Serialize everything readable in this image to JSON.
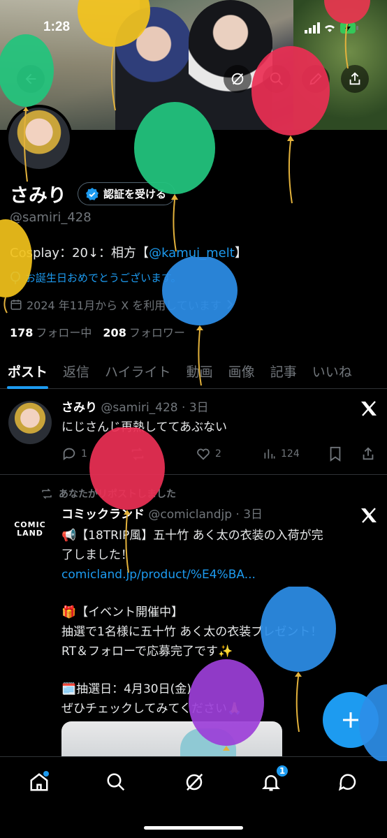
{
  "status_bar": {
    "time": "1:28"
  },
  "profile": {
    "name": "さみり",
    "verify_label": "認証を受ける",
    "handle": "@samiri_428",
    "bio_prefix": "Cosplay：20↓：相方【",
    "bio_mention": "@kamui_melt",
    "bio_suffix": "】",
    "birthday": "お誕生日おめでとうございます。",
    "joined": "2024 年11月から X を利用しています",
    "following_count": "178",
    "following_label": "フォロー中",
    "followers_count": "208",
    "followers_label": "フォロワー"
  },
  "tabs": [
    "ポスト",
    "返信",
    "ハイライト",
    "動画",
    "画像",
    "記事",
    "いいね"
  ],
  "post1": {
    "name": "さみり",
    "handle_time": "@samiri_428 · 3日",
    "text": "にじさんじ再熱しててあぶない",
    "reply_count": "1",
    "like_count": "2",
    "view_count": "124"
  },
  "post2": {
    "repost_label": "あなたがリポストしました",
    "logo_text_1": "COMIC",
    "logo_text_2": "LAND",
    "name": "コミックランド",
    "handle_time": "@comiclandjp · 3日",
    "line1": "📢【18TRIP風】五十竹 あく太の衣装の入荷が完",
    "line2": "了しました！",
    "link": "comicland.jp/product/%E4%BA...",
    "line3": "🎁【イベント開催中】",
    "line4": "抽選で1名様に五十竹 あく太の衣装プレゼント！",
    "line5": "RT＆フォローで応募完了です✨",
    "line6": "🗓️抽選日：4月30日(金)",
    "line7": "ぜひチェックしてみてください🙏"
  },
  "nav": {
    "notification_badge": "1"
  },
  "colors": {
    "accent": "#1d9bf0",
    "background": "#000000",
    "muted": "#71767b"
  }
}
